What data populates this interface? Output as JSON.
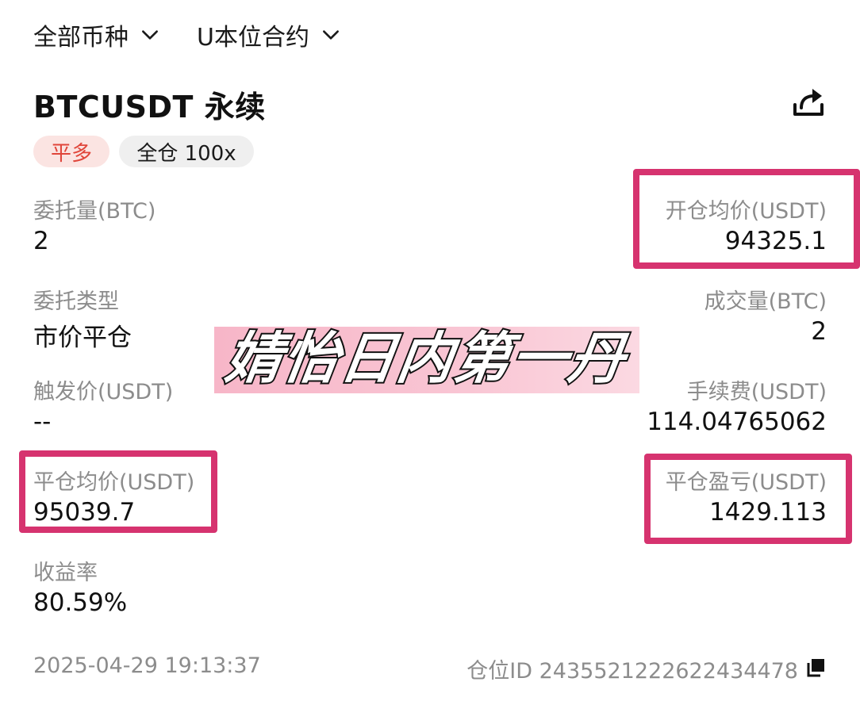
{
  "filters": {
    "coin": "全部币种",
    "contract": "U本位合约"
  },
  "header": {
    "title": "BTCUSDT 永续"
  },
  "tags": {
    "side": "平多",
    "margin": "全仓 100x"
  },
  "fields": {
    "order_qty": {
      "label": "委托量(BTC)",
      "value": "2"
    },
    "open_avg": {
      "label": "开仓均价(USDT)",
      "value": "94325.1"
    },
    "order_type": {
      "label": "委托类型",
      "value": "市价平仓"
    },
    "filled_qty": {
      "label": "成交量(BTC)",
      "value": "2"
    },
    "trigger_price": {
      "label": "触发价(USDT)",
      "value": "--"
    },
    "fee": {
      "label": "手续费(USDT)",
      "value": "114.04765062"
    },
    "close_avg": {
      "label": "平仓均价(USDT)",
      "value": "95039.7"
    },
    "close_pnl": {
      "label": "平仓盈亏(USDT)",
      "value": "1429.113"
    },
    "roi": {
      "label": "收益率",
      "value": "80.59%"
    }
  },
  "watermark": "婧怡日内第一丹",
  "footer": {
    "timestamp": "2025-04-29 19:13:37",
    "position_id": "仓位ID 2435521222622434478"
  },
  "colors": {
    "highlight": "#d6336f",
    "long_tag_bg": "#fbe4e2",
    "long_tag_text": "#e0453a",
    "label_gray": "#8c8c8c"
  },
  "icons": {
    "dropdown": "chevron-down-icon",
    "share": "share-icon",
    "copy": "copy-icon"
  }
}
